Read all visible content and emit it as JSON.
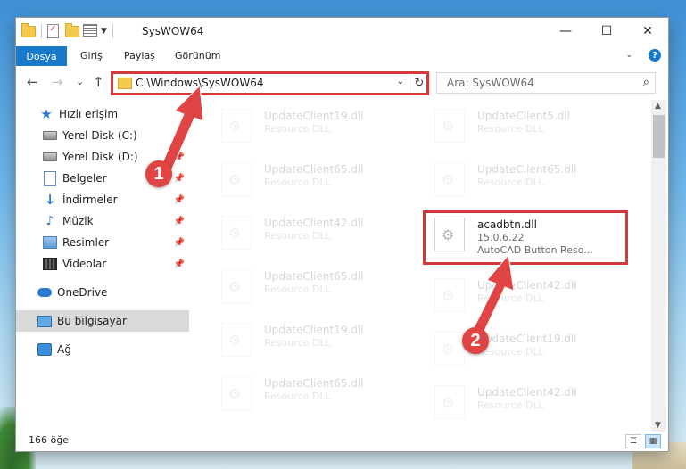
{
  "window": {
    "title": "SysWOW64",
    "controls": {
      "minimize": "—",
      "maximize": "☐",
      "close": "✕"
    }
  },
  "ribbon": {
    "file_tab": "Dosya",
    "tabs": [
      "Giriş",
      "Paylaş",
      "Görünüm"
    ],
    "help": "?"
  },
  "navigation": {
    "back": "←",
    "forward": "→",
    "recent": "⌄",
    "up": "↑",
    "address": "C:\\Windows\\SysWOW64",
    "search_placeholder": "Ara: SysWOW64"
  },
  "sidebar": {
    "items": [
      {
        "label": "Hızlı erişim",
        "icon": "star-icon"
      },
      {
        "label": "Yerel Disk (C:)",
        "icon": "drive-icon",
        "pinned": true
      },
      {
        "label": "Yerel Disk (D:)",
        "icon": "drive-icon",
        "pinned": true
      },
      {
        "label": "Belgeler",
        "icon": "documents-icon",
        "pinned": true
      },
      {
        "label": "İndirmeler",
        "icon": "downloads-icon",
        "pinned": true
      },
      {
        "label": "Müzik",
        "icon": "music-icon",
        "pinned": true
      },
      {
        "label": "Resimler",
        "icon": "pictures-icon",
        "pinned": true
      },
      {
        "label": "Videolar",
        "icon": "videos-icon",
        "pinned": true
      },
      {
        "label": "OneDrive",
        "icon": "cloud-icon"
      },
      {
        "label": "Bu bilgisayar",
        "icon": "computer-icon",
        "selected": true
      },
      {
        "label": "Ağ",
        "icon": "network-icon"
      }
    ]
  },
  "files": {
    "faded_type": "Resource DLL",
    "left_column": [
      "UpdateClient19.dll",
      "UpdateClient65.dll",
      "UpdateClient42.dll",
      "UpdateClient65.dll",
      "UpdateClient19.dll",
      "UpdateClient65.dll"
    ],
    "right_column": [
      "UpdateClient5.dll",
      "UpdateClient65.dll",
      "UpdateClient42.dll",
      "UpdateClient19.dll",
      "UpdateClient42.dll"
    ],
    "selected": {
      "name": "acadbtn.dll",
      "version": "15.0.6.22",
      "description": "AutoCAD Button Reso..."
    }
  },
  "status": {
    "item_count": "166 öğe"
  },
  "annotations": {
    "step1": "1",
    "step2": "2",
    "color": "#d13a3a"
  }
}
